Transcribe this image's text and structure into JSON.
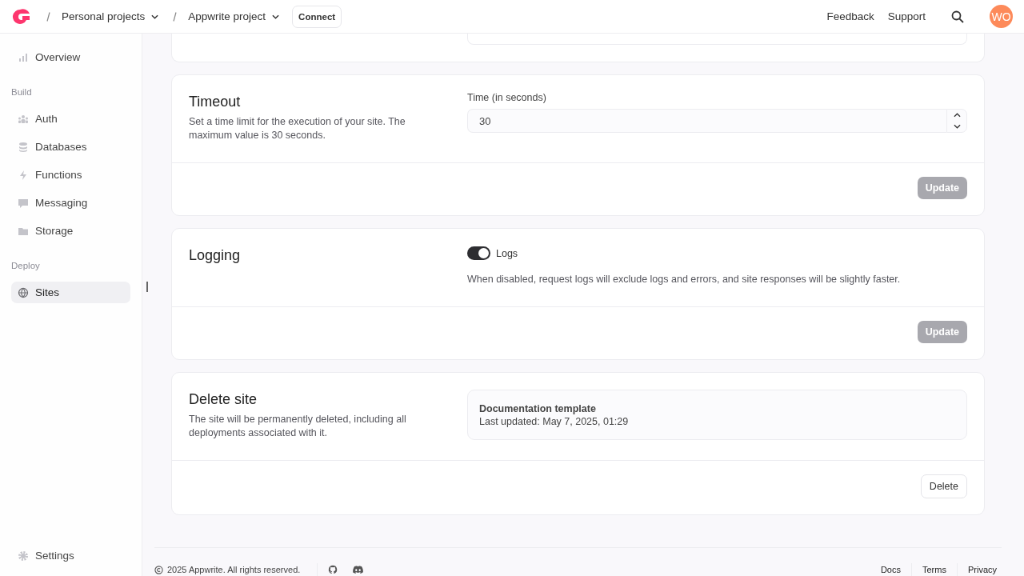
{
  "header": {
    "breadcrumbs": [
      {
        "label": "Personal projects"
      },
      {
        "label": "Appwrite project"
      }
    ],
    "connect": "Connect",
    "links": [
      "Feedback",
      "Support"
    ],
    "avatar": "WO"
  },
  "sidebar": {
    "sections": [
      {
        "items": [
          {
            "label": "Overview",
            "selected": false
          }
        ]
      },
      {
        "title": "Build",
        "items": [
          {
            "label": "Auth",
            "selected": false
          },
          {
            "label": "Databases",
            "selected": false
          },
          {
            "label": "Functions",
            "selected": false
          },
          {
            "label": "Messaging",
            "selected": false
          },
          {
            "label": "Storage",
            "selected": false
          }
        ]
      },
      {
        "title": "Deploy",
        "items": [
          {
            "label": "Sites",
            "selected": true
          }
        ]
      }
    ],
    "settings": "Settings"
  },
  "timeout": {
    "title": "Timeout",
    "description": "Set a time limit for the execution of your site. The maximum value is 30 seconds.",
    "field_label": "Time (in seconds)",
    "value": "30",
    "button": "Update",
    "disabled": true
  },
  "logging": {
    "title": "Logging",
    "toggle_label": "Logs",
    "on": true,
    "description": "When disabled, request logs will exclude logs and errors, and site responses will be slightly faster.",
    "button": "Update",
    "disabled": true
  },
  "delete_site": {
    "title": "Delete site",
    "description": "The site will be permanently deleted, including all deployments associated with it.",
    "site_name": "Documentation template",
    "updated": "Last updated: May 7, 2025, 01:29",
    "button": "Delete"
  },
  "footer": {
    "copyright": "2025 Appwrite. All rights reserved.",
    "links": [
      "Docs",
      "Terms",
      "Privacy"
    ]
  }
}
